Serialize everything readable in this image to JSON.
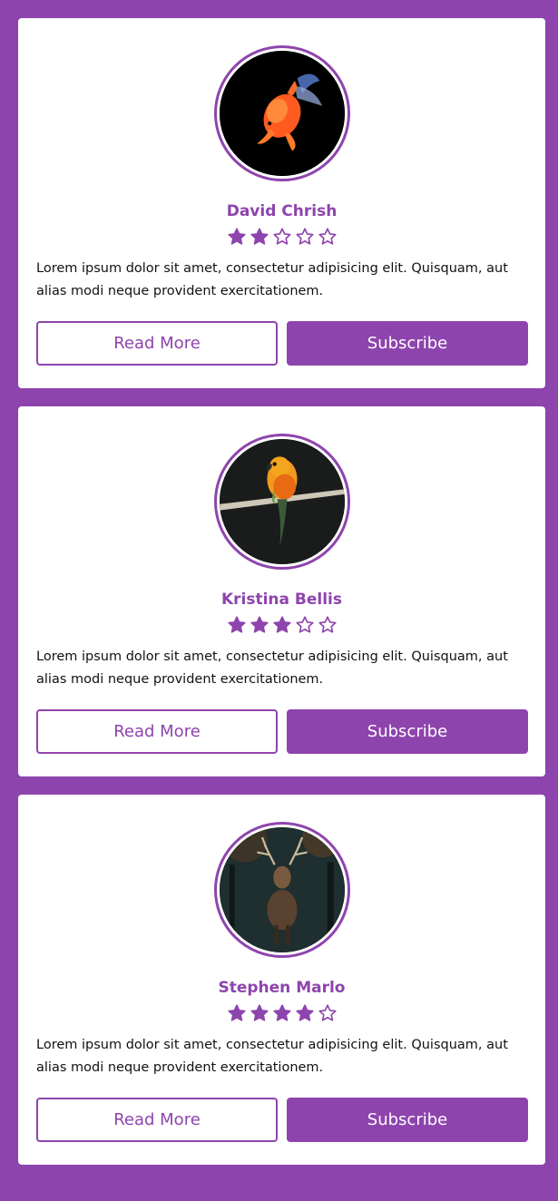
{
  "theme": {
    "accent": "#8e44ad",
    "card_bg": "#ffffff",
    "text": "#111111"
  },
  "cards": [
    {
      "name": "David Chrish",
      "rating": 2,
      "max_rating": 5,
      "image": "goldfish-photo",
      "description": "Lorem ipsum dolor sit amet, consectetur adipisicing elit. Quisquam, aut alias modi neque provident exercitationem.",
      "read_more_label": "Read More",
      "subscribe_label": "Subscribe"
    },
    {
      "name": "Kristina Bellis",
      "rating": 3,
      "max_rating": 5,
      "image": "parrot-photo",
      "description": "Lorem ipsum dolor sit amet, consectetur adipisicing elit. Quisquam, aut alias modi neque provident exercitationem.",
      "read_more_label": "Read More",
      "subscribe_label": "Subscribe"
    },
    {
      "name": "Stephen Marlo",
      "rating": 4,
      "max_rating": 5,
      "image": "deer-photo",
      "description": "Lorem ipsum dolor sit amet, consectetur adipisicing elit. Quisquam, aut alias modi neque provident exercitationem.",
      "read_more_label": "Read More",
      "subscribe_label": "Subscribe"
    }
  ]
}
